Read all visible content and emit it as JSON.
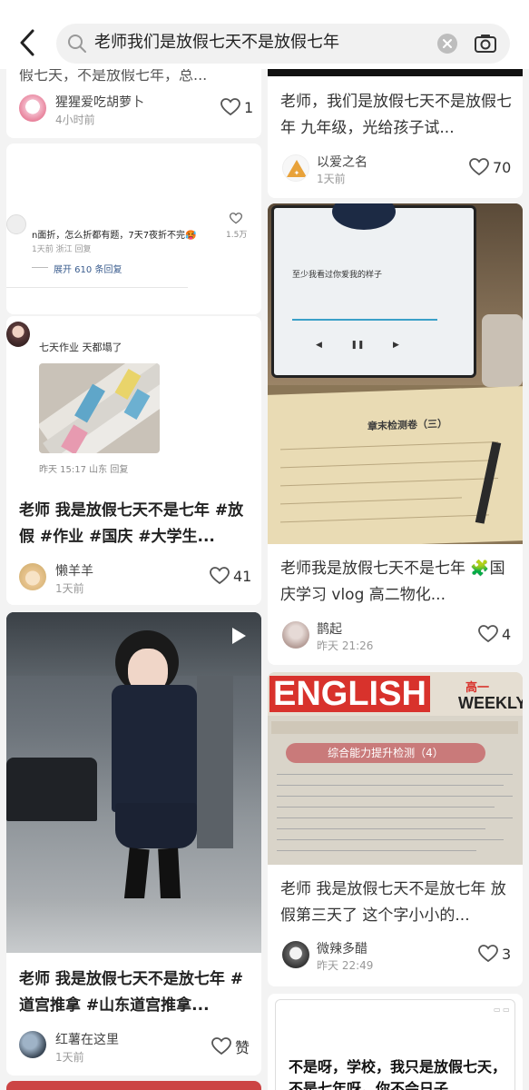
{
  "search": {
    "query": "老师我们是放假七天不是放假七年"
  },
  "left_column": {
    "card1": {
      "title_top": "假七天，不是放假七年，总...",
      "author": "猩猩爱吃胡萝卜",
      "time": "4小时前",
      "likes": "1"
    },
    "card2": {
      "comment_text": "n面折，怎么折都有题，7天7夜折不完🥵",
      "comment_likes": "1.5万",
      "comment_meta": "1天前 浙江 回复",
      "expand": "展开 610 条回复"
    },
    "card3": {
      "chat_text": "七天作业 天都塌了",
      "chat_meta": "昨天 15:17 山东 回复",
      "title": "老师 我是放假七天不是七年 #放假 #作业 #国庆 #大学生...",
      "author": "懒羊羊",
      "time": "1天前",
      "likes": "41"
    },
    "card4": {
      "title": "老师 我是放假七天不是放七年 #道宫推拿 #山东道宫推拿...",
      "author": "红薯在这里",
      "time": "1天前",
      "likes": "赞"
    }
  },
  "right_column": {
    "card1": {
      "title": "老师，我们是放假七天不是放假七年 九年级，光给孩子试...",
      "author": "以爱之名",
      "time": "1天前",
      "likes": "70"
    },
    "card2": {
      "lyric": "至少我看过你爱我的样子",
      "exam_title": "章末检测卷（三）",
      "title": "老师我是放假七天不是七年 🧩国庆学习 vlog 高二物化...",
      "author": "鹊起",
      "time": "昨天 21:26",
      "likes": "4"
    },
    "card3": {
      "brand": "ENGLISH",
      "brand2": "WEEKLY",
      "grade": "高一",
      "banner": "综合能力提升检测（4）",
      "title": "老师 我是放假七天不是放七年 放假第三天了 这个字小小的...",
      "author": "微辣多醋",
      "time": "昨天 22:49",
      "likes": "3"
    },
    "card4": {
      "text": "不是呀，学校，我只是放假七天，不是七年呀。你不会日子"
    }
  },
  "colors": {
    "background": "#f3f3f3",
    "card": "#ffffff",
    "english_red": "#d8322c"
  }
}
